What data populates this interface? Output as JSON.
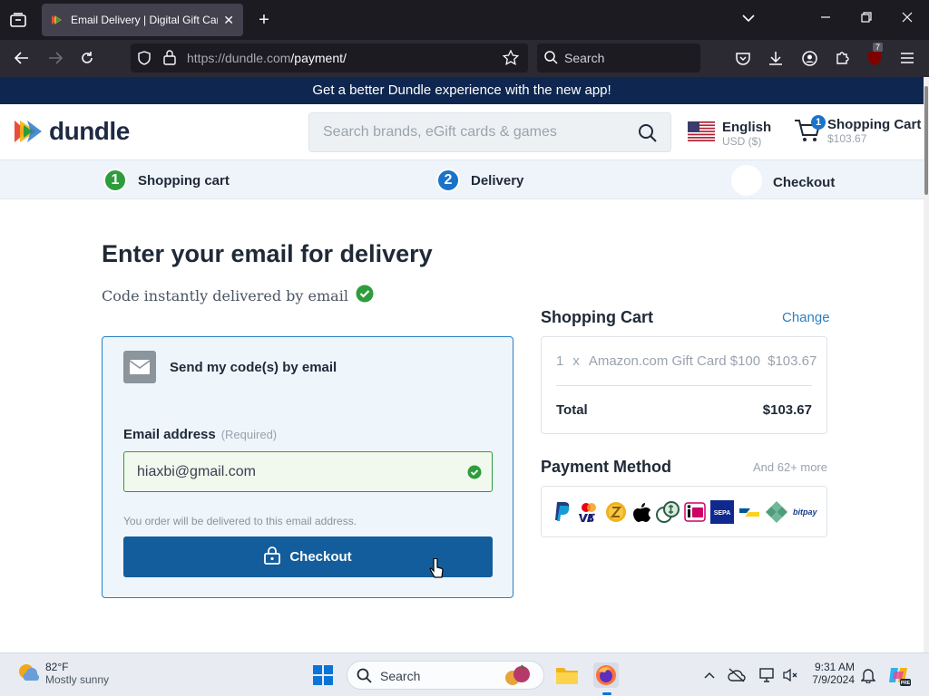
{
  "browser": {
    "tab_title": "Email Delivery | Digital Gift Card",
    "url_host": "https://dundle.com",
    "url_path": "/payment/",
    "search_placeholder": "Search",
    "extension_badge": "7"
  },
  "promo": {
    "text": "Get a better Dundle experience with the new app!"
  },
  "header": {
    "logo_text": "dundle",
    "search_placeholder": "Search brands, eGift cards & games",
    "language": "English",
    "currency": "USD ($)",
    "cart_label": "Shopping Cart",
    "cart_amount": "$103.67",
    "cart_count": "1"
  },
  "steps": [
    {
      "num": "1",
      "label": "Shopping cart",
      "color": "#2e9c3c"
    },
    {
      "num": "2",
      "label": "Delivery",
      "color": "#1a73c8"
    },
    {
      "num": "",
      "label": "Checkout",
      "color": "#ffffff"
    }
  ],
  "main": {
    "heading": "Enter your email for delivery",
    "subheading": "Code instantly delivered by email",
    "delivery_option": "Send my code(s) by email",
    "email_label": "Email address",
    "email_required": "(Required)",
    "email_value": "hiaxbi@gmail.com",
    "hint": "You order will be delivered to this email address.",
    "checkout_button": "Checkout"
  },
  "cart_summary": {
    "title": "Shopping Cart",
    "change": "Change",
    "items": [
      {
        "qty": "1",
        "x": "x",
        "name": "Amazon.com Gift Card $100",
        "price": "$103.67"
      }
    ],
    "total_label": "Total",
    "total_value": "$103.67"
  },
  "payment": {
    "title": "Payment Method",
    "more": "And 62+ more",
    "methods": [
      "paypal-icon",
      "mastercard-visa-icon",
      "z-coin-icon",
      "apple-pay-icon",
      "crypto-coins-icon",
      "ideal-icon",
      "sepa-icon",
      "bancontact-icon",
      "diamond-icon",
      "bitpay-icon"
    ]
  },
  "taskbar": {
    "temp": "82°F",
    "weather": "Mostly sunny",
    "search_placeholder": "Search",
    "time": "9:31 AM",
    "date": "7/9/2024"
  },
  "colors": {
    "brand_blue": "#135d9c",
    "promo_bg": "#0f2750",
    "success_green": "#2e9c3c",
    "link_blue": "#2b7fc2"
  }
}
